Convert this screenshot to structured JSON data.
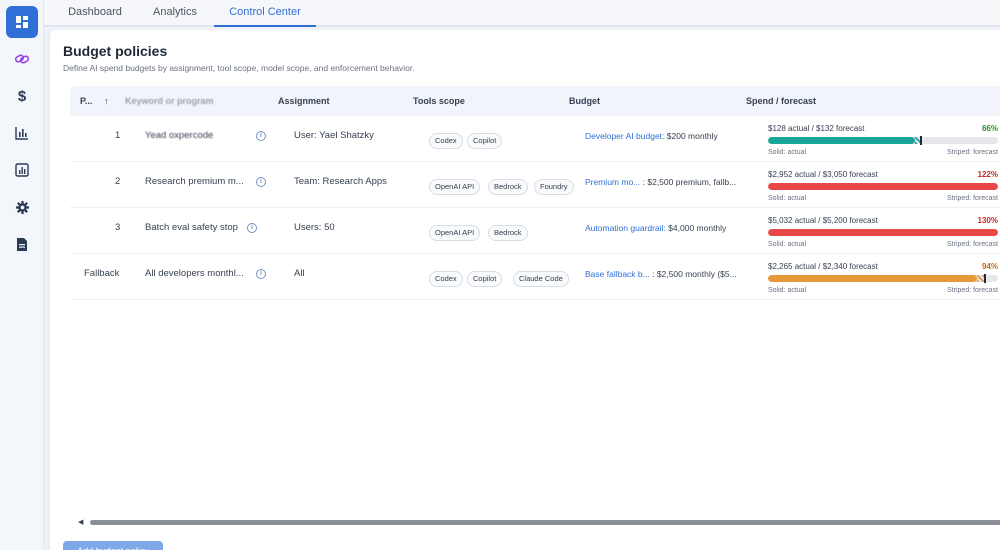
{
  "sidebar": {
    "items": [
      {
        "icon": "dashboard-icon",
        "active": true
      },
      {
        "icon": "link-icon"
      },
      {
        "icon": "dollar-icon"
      },
      {
        "icon": "bar-chart-icon"
      },
      {
        "icon": "report-chart-icon"
      },
      {
        "icon": "gear-icon"
      },
      {
        "icon": "document-icon"
      }
    ]
  },
  "tabs": [
    {
      "label": "Dashboard",
      "active": false
    },
    {
      "label": "Analytics",
      "active": false
    },
    {
      "label": "Control Center",
      "active": true
    }
  ],
  "page": {
    "title": "Budget policies",
    "subtitle": "Define AI spend budgets by assignment, tool scope, model scope, and enforcement behavior."
  },
  "table": {
    "columns": {
      "priority": "P...",
      "sort_icon": "↑",
      "name": "Keyword or program",
      "assignment": "Assignment",
      "tools": "Tools scope",
      "budget": "Budget",
      "spend": "Spend / forecast"
    },
    "rows": [
      {
        "priority": "1",
        "name": "Yead oxpercode",
        "assignment": "User: Yael Shatzky",
        "tools": [
          "Codex",
          "Copilot"
        ],
        "budget_name": "Developer AI budget:",
        "budget_detail": "$200 monthly",
        "spend_text": "$128 actual / $132 forecast",
        "percent": "66%",
        "actual_frac": 0.64,
        "forecast_frac": 0.66,
        "color": "#1aa59a",
        "pct_color": "#2e8b2e",
        "solid_label": "Solid: actual",
        "striped_label": "Striped: forecast"
      },
      {
        "priority": "2",
        "name": "Research premium m...",
        "assignment": "Team: Research Apps",
        "tools": [
          "OpenAI API",
          "Bedrock",
          "Foundry"
        ],
        "budget_name": "Premium mo...",
        "budget_detail": ": $2,500 premium, fallb...",
        "spend_text": "$2,952 actual / $3,050 forecast",
        "percent": "122%",
        "actual_frac": 1.0,
        "forecast_frac": 1.0,
        "color": "#e84747",
        "pct_color": "#c62828",
        "solid_label": "Solid: actual",
        "striped_label": "Striped: forecast"
      },
      {
        "priority": "3",
        "name": "Batch eval safety stop",
        "assignment": "Users: 50",
        "tools": [
          "OpenAI API",
          "Bedrock"
        ],
        "budget_name": "Automation guardrail:",
        "budget_detail": "$4,000 monthly",
        "spend_text": "$5,032 actual / $5,200 forecast",
        "percent": "130%",
        "actual_frac": 1.0,
        "forecast_frac": 1.0,
        "color": "#e84747",
        "pct_color": "#c62828",
        "solid_label": "Solid: actual",
        "striped_label": "Striped: forecast"
      },
      {
        "priority": "Fallback",
        "name": "All developers monthl...",
        "assignment": "All",
        "tools": [
          "Codex",
          "Copilot",
          "Claude Code"
        ],
        "budget_name": "Base fallback b...",
        "budget_detail": ": $2,500 monthly ($5...",
        "spend_text": "$2,265 actual / $2,340 forecast",
        "percent": "94%",
        "actual_frac": 0.91,
        "forecast_frac": 0.94,
        "color": "#e8973a",
        "pct_color": "#c26a10",
        "solid_label": "Solid: actual",
        "striped_label": "Striped: forecast"
      }
    ]
  },
  "footer": {
    "add_button": "Add budget policy"
  },
  "colors": {
    "accent": "#2f6fd6",
    "teal": "#1aa59a",
    "red": "#e84747",
    "orange": "#e8973a"
  }
}
